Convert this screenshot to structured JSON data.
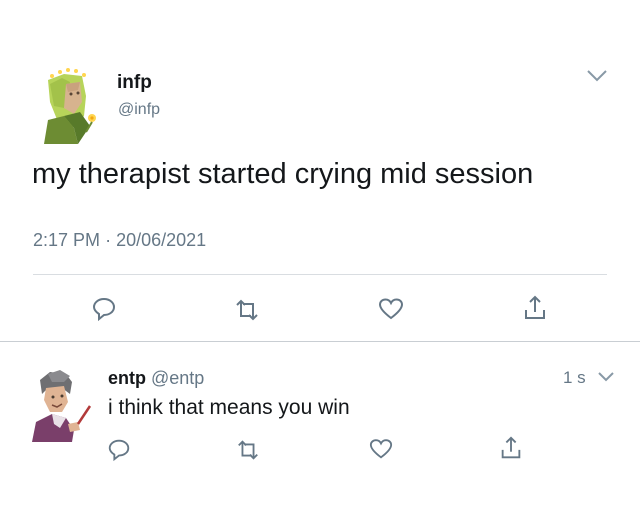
{
  "tweet": {
    "display_name": "infp",
    "handle": "@infp",
    "text": "my therapist started crying mid session",
    "time": "2:17 PM",
    "separator": "·",
    "date": "20/06/2021",
    "avatar_icon": "infp-avatar-icon",
    "menu_icon": "chevron-down-icon",
    "actions": [
      "reply-icon",
      "retweet-icon",
      "like-icon",
      "share-icon"
    ]
  },
  "reply": {
    "display_name": "entp",
    "handle": "@entp",
    "text": "i think that means you win",
    "age": "1 s",
    "avatar_icon": "entp-avatar-icon",
    "menu_icon": "chevron-down-icon",
    "actions": [
      "reply-icon",
      "retweet-icon",
      "like-icon",
      "share-icon"
    ]
  },
  "colors": {
    "text": "#14171a",
    "secondary": "#657786",
    "divider": "#d9dde1",
    "icon": "#657786"
  }
}
